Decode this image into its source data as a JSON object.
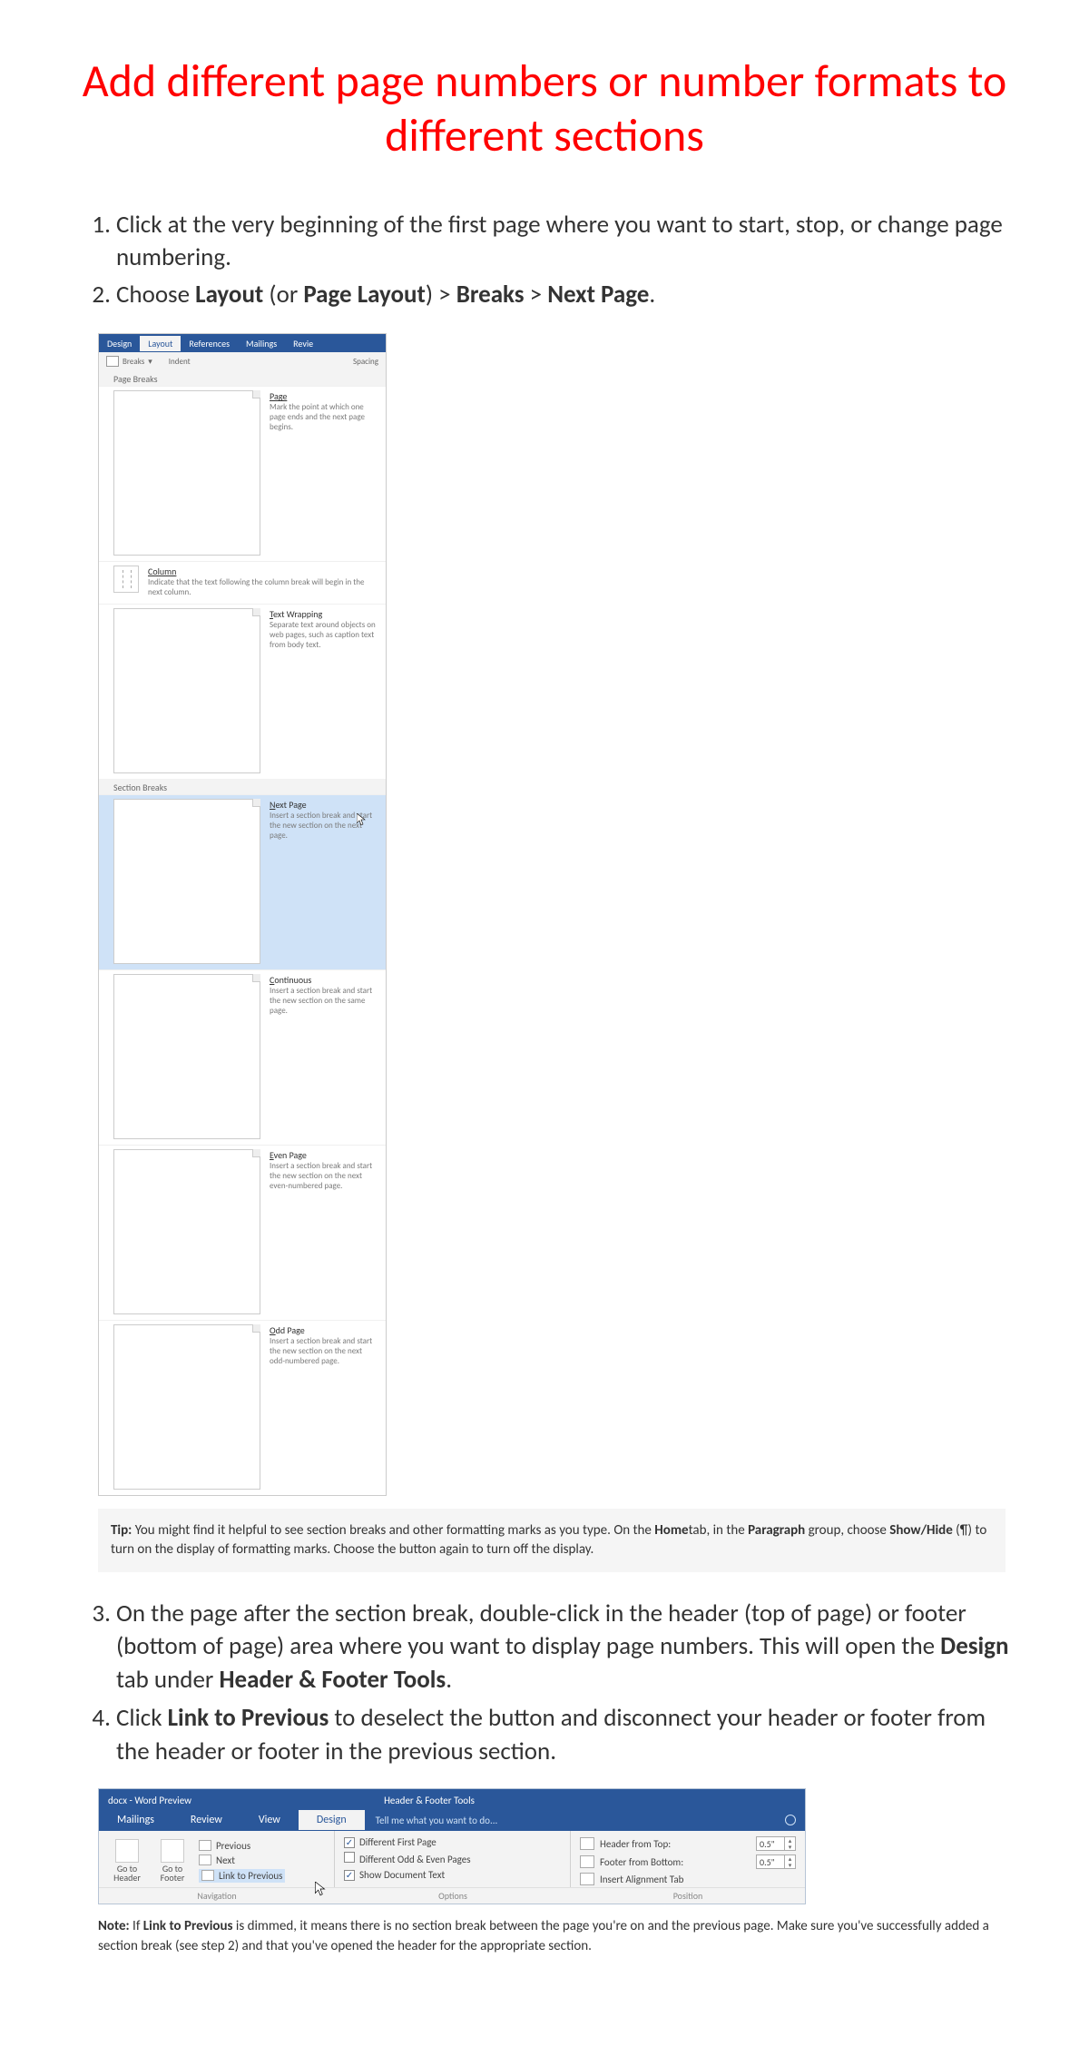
{
  "title": "Add different page numbers or number formats to different sections",
  "steps12": {
    "s1": "Click at the very beginning of the first page where you want to start, stop, or change page numbering.",
    "s2_pre": "Choose ",
    "s2_layout": "Layout",
    "s2_or": " (or ",
    "s2_pagelayout": "Page Layout",
    "s2_gt1": ") > ",
    "s2_breaks": "Breaks",
    "s2_gt2": " > ",
    "s2_nextpage": "Next Page",
    "s2_end": "."
  },
  "breaks_menu": {
    "tabs": {
      "design": "Design",
      "layout": "Layout",
      "references": "References",
      "mailings": "Mailings",
      "review": "Revie"
    },
    "strip": {
      "breaks": "Breaks",
      "indent": "Indent",
      "spacing": "Spacing"
    },
    "sec1": "Page Breaks",
    "items_page": [
      {
        "t": "Page",
        "d": "Mark the point at which one page ends and the next page begins."
      },
      {
        "t": "Column",
        "d": "Indicate that the text following the column break will begin in the next column."
      },
      {
        "t": "Text Wrapping",
        "d": "Separate text around objects on web pages, such as caption text from body text."
      }
    ],
    "sec2": "Section Breaks",
    "items_section": [
      {
        "t": "Next Page",
        "d": "Insert a section break and start the new section on the next page."
      },
      {
        "t": "Continuous",
        "d": "Insert a section break and start the new section on the same page."
      },
      {
        "t": "Even Page",
        "d": "Insert a section break and start the new section on the next even-numbered page."
      },
      {
        "t": "Odd Page",
        "d": "Insert a section break and start the new section on the next odd-numbered page."
      }
    ]
  },
  "tip": {
    "label": "Tip:",
    "t1": " You might find it helpful to see section breaks and other formatting marks as you type. On the ",
    "home": "Home",
    "t2": "tab, in the ",
    "para": "Paragraph",
    "t3": " group, choose ",
    "sh": "Show/Hide",
    "t4": " (¶) to turn on the display of formatting marks. Choose the button again to turn off the display."
  },
  "steps34": {
    "s3_a": "On the page after the section break, double-click in the header (top of page) or footer (bottom of page) area where you want to display page numbers. This will open the ",
    "s3_design": "Design",
    "s3_b": " tab under ",
    "s3_hft": "Header & Footer Tools",
    "s3_c": ".",
    "s4_a": "Click ",
    "s4_link": "Link to Previous",
    "s4_b": " to deselect the button and disconnect your header or footer from the header or footer in the previous section."
  },
  "hft": {
    "title_left": "docx - Word Preview",
    "title_center": "Header & Footer Tools",
    "tabs": {
      "mailings": "Mailings",
      "review": "Review",
      "view": "View",
      "design": "Design",
      "tell": "Tell me what you want to do..."
    },
    "nav": {
      "goto_header_a": "Go to",
      "goto_header_b": "Header",
      "goto_footer_a": "Go to",
      "goto_footer_b": "Footer",
      "previous": "Previous",
      "next": "Next",
      "link": "Link to Previous",
      "label": "Navigation"
    },
    "opts": {
      "dfp": "Different First Page",
      "doe": "Different Odd & Even Pages",
      "sdt": "Show Document Text",
      "label": "Options"
    },
    "pos": {
      "hft": "Header from Top:",
      "ffb": "Footer from Bottom:",
      "iat": "Insert Alignment Tab",
      "v1": "0.5\"",
      "v2": "0.5\"",
      "label": "Position"
    }
  },
  "note": {
    "label": "Note:",
    "t1": " If ",
    "link": "Link to Previous",
    "t2": " is dimmed, it means there is no section break between the page you're on and the previous page. Make sure you've successfully added a section break (see step 2) and that you've opened the header for the appropriate section."
  }
}
